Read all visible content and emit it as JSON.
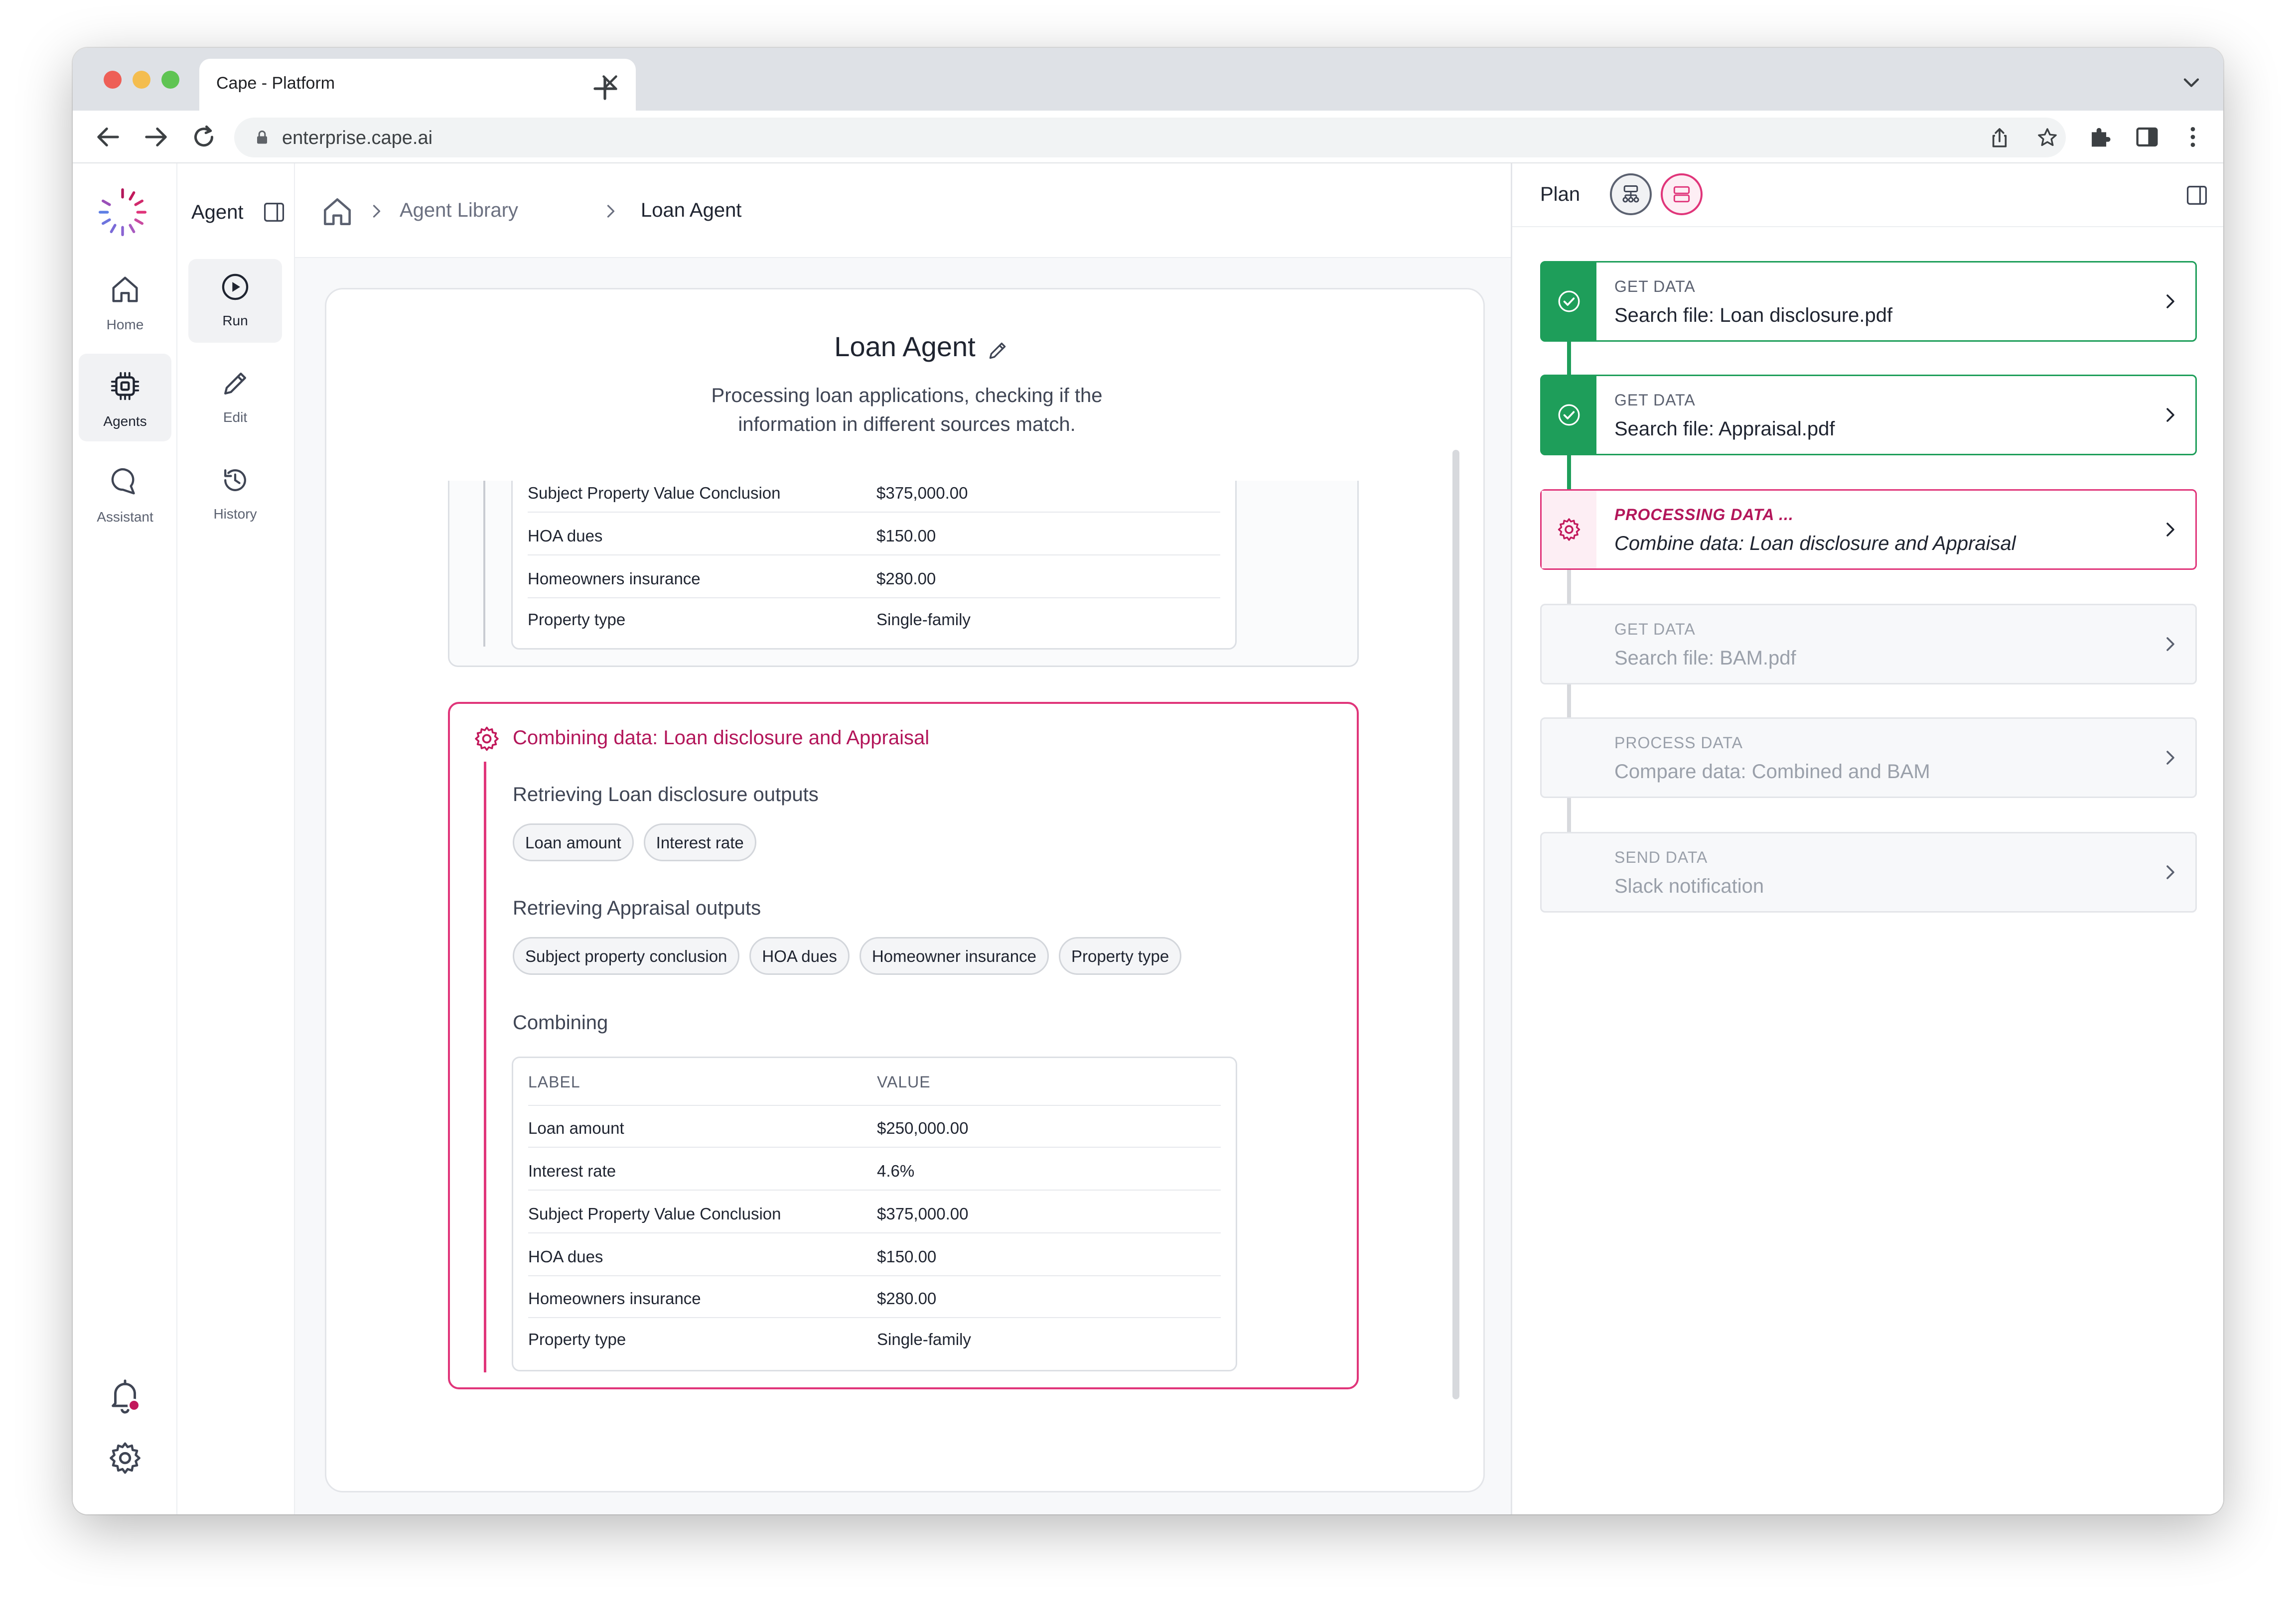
{
  "browser": {
    "tab_title": "Cape - Platform",
    "url": "enterprise.cape.ai"
  },
  "rail": {
    "items": [
      {
        "label": "Home"
      },
      {
        "label": "Agents"
      },
      {
        "label": "Assistant"
      }
    ]
  },
  "subnav": {
    "title": "Agent",
    "items": [
      {
        "label": "Run"
      },
      {
        "label": "Edit"
      },
      {
        "label": "History"
      }
    ]
  },
  "breadcrumb": {
    "items": [
      "Agent Library",
      "Loan Agent"
    ]
  },
  "agent": {
    "title": "Loan Agent",
    "description": "Processing loan applications, checking if the information in different sources match."
  },
  "top_table": {
    "rows": [
      {
        "label": "Subject Property Value Conclusion",
        "value": "$375,000.00"
      },
      {
        "label": "HOA dues",
        "value": "$150.00"
      },
      {
        "label": "Homeowners insurance",
        "value": "$280.00"
      },
      {
        "label": "Property type",
        "value": "Single-family"
      }
    ]
  },
  "combine": {
    "title": "Combining data: Loan disclosure and Appraisal",
    "loan_heading": "Retrieving Loan disclosure outputs",
    "loan_chips": [
      "Loan amount",
      "Interest rate"
    ],
    "appraisal_heading": "Retrieving Appraisal outputs",
    "appraisal_chips": [
      "Subject property conclusion",
      "HOA dues",
      "Homeowner insurance",
      "Property type"
    ],
    "combining_heading": "Combining",
    "table": {
      "headers": [
        "LABEL",
        "VALUE"
      ],
      "rows": [
        {
          "label": "Loan amount",
          "value": "$250,000.00"
        },
        {
          "label": "Interest rate",
          "value": "4.6%"
        },
        {
          "label": "Subject Property Value Conclusion",
          "value": "$375,000.00"
        },
        {
          "label": "HOA dues",
          "value": "$150.00"
        },
        {
          "label": "Homeowners insurance",
          "value": "$280.00"
        },
        {
          "label": "Property type",
          "value": "Single-family"
        }
      ]
    }
  },
  "plan": {
    "title": "Plan",
    "steps": [
      {
        "label": "GET DATA",
        "text": "Search file: Loan disclosure.pdf",
        "status": "done"
      },
      {
        "label": "GET DATA",
        "text": "Search file: Appraisal.pdf",
        "status": "done"
      },
      {
        "label": "PROCESSING DATA ...",
        "text": "Combine data: Loan disclosure and Appraisal",
        "status": "active"
      },
      {
        "label": "GET DATA",
        "text": "Search file: BAM.pdf",
        "status": "pending"
      },
      {
        "label": "PROCESS DATA",
        "text": "Compare data: Combined and BAM",
        "status": "pending"
      },
      {
        "label": "SEND DATA",
        "text": "Slack notification",
        "status": "pending"
      }
    ]
  },
  "colors": {
    "accent_pink": "#e0357a",
    "success_green": "#1e9e5a",
    "notification_dot": "#c2185b"
  },
  "icons": [
    "home-icon",
    "agents-chip-icon",
    "assistant-chat-icon",
    "run-play-icon",
    "edit-pencil-icon",
    "history-clock-icon",
    "bell-icon",
    "settings-gear-icon",
    "check-circle-icon",
    "gear-icon",
    "chevron-right-icon"
  ]
}
